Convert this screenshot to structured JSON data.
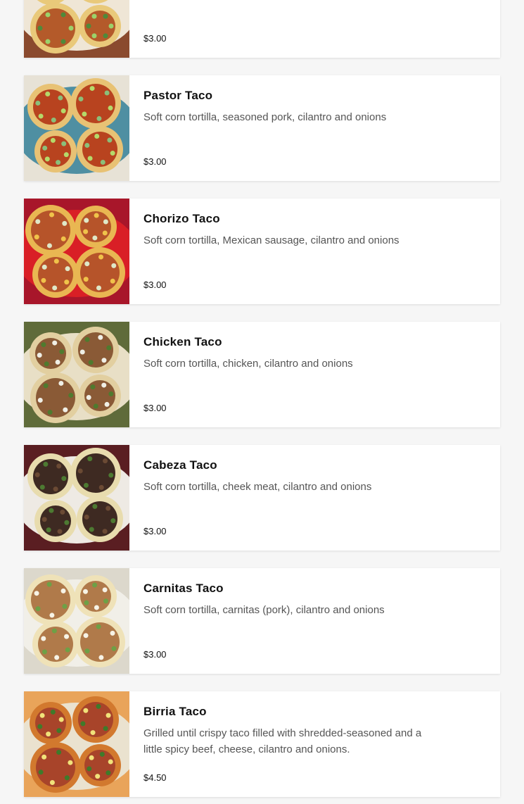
{
  "menu": {
    "items": [
      {
        "name": "",
        "description": "",
        "price": "$3.00",
        "image": "plated-tacos-photo",
        "palette": {
          "bg": "#8a4a2e",
          "plate": "#efe6d6",
          "tortilla": "#e9c97a",
          "filling": "#b45a2a",
          "garnish": "#4f8a3a",
          "accent": "#9bd26a"
        }
      },
      {
        "name": "Pastor Taco",
        "description": "Soft corn tortilla, seasoned pork, cilantro and onions",
        "price": "$3.00",
        "image": "pastor-taco-photo",
        "palette": {
          "bg": "#e7e2d6",
          "plate": "#4f8fa2",
          "tortilla": "#e8c274",
          "filling": "#b8431f",
          "garnish": "#8bbf7a",
          "accent": "#b5d96a"
        }
      },
      {
        "name": "Chorizo Taco",
        "description": "Soft corn tortilla, Mexican sausage, cilantro and onions",
        "price": "$3.00",
        "image": "chorizo-taco-photo",
        "palette": {
          "bg": "#a8162a",
          "plate": "#d91f26",
          "tortilla": "#e9b752",
          "filling": "#b6542a",
          "garnish": "#dfe8c8",
          "accent": "#f0c34a"
        }
      },
      {
        "name": "Chicken Taco",
        "description": "Soft corn tortilla, chicken, cilantro and onions",
        "price": "$3.00",
        "image": "chicken-taco-photo",
        "palette": {
          "bg": "#5f6b3a",
          "plate": "#e8dfc6",
          "tortilla": "#e2cfa0",
          "filling": "#8a5a36",
          "garnish": "#4f7a2e",
          "accent": "#f0efe6"
        }
      },
      {
        "name": "Cabeza Taco",
        "description": "Soft corn tortilla, cheek meat, cilantro and onions",
        "price": "$3.00",
        "image": "cabeza-taco-photo",
        "palette": {
          "bg": "#5a1e22",
          "plate": "#eeeae4",
          "tortilla": "#e8dcae",
          "filling": "#3e2a22",
          "garnish": "#4d7a32",
          "accent": "#6b4a34"
        }
      },
      {
        "name": "Carnitas Taco",
        "description": "Soft corn tortilla, carnitas (pork), cilantro and onions",
        "price": "$3.00",
        "image": "carnitas-taco-photo",
        "palette": {
          "bg": "#dcd8cc",
          "plate": "#f1efe8",
          "tortilla": "#efe2b8",
          "filling": "#b07a4a",
          "garnish": "#6ea046",
          "accent": "#f7f3e6"
        }
      },
      {
        "name": "Birria Taco",
        "description": "Grilled until crispy taco filled with shredded-seasoned and a little spicy beef, cheese, cilantro and onions.",
        "price": "$4.50",
        "image": "birria-taco-photo",
        "palette": {
          "bg": "#e9a45a",
          "plate": "#eae2cf",
          "tortilla": "#d2792e",
          "filling": "#a8442a",
          "garnish": "#3f7a2a",
          "accent": "#f1e27a"
        }
      }
    ]
  }
}
